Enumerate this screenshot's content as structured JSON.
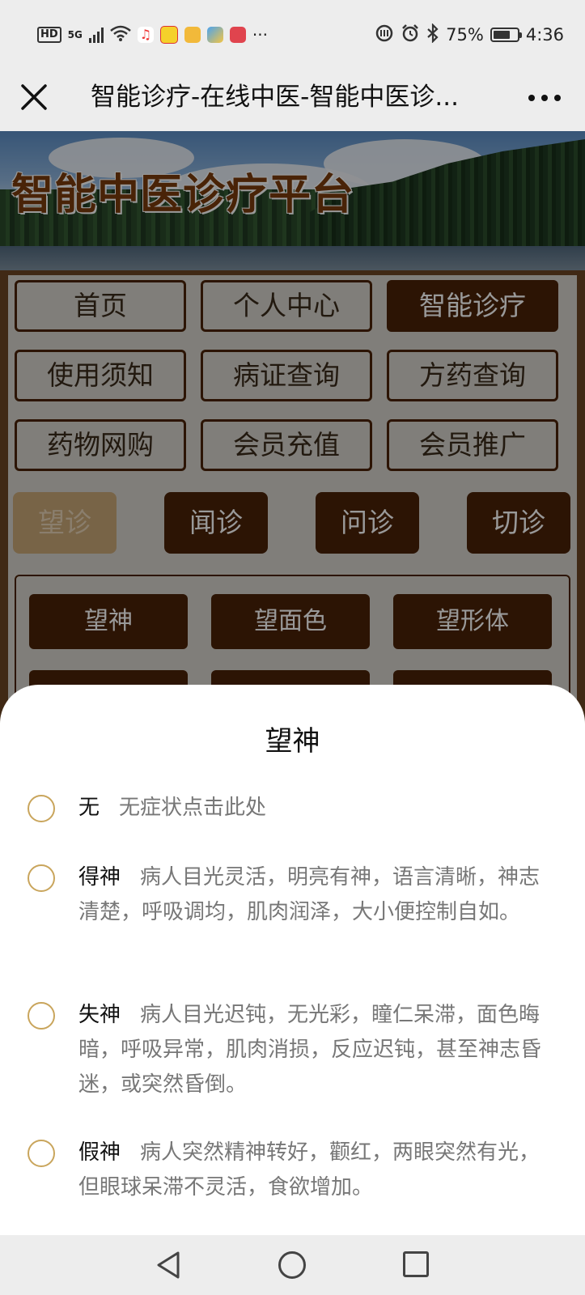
{
  "status_bar": {
    "network": "HD",
    "signal": "5G",
    "more": "···",
    "battery": "75%",
    "battery_level": 0.75,
    "time": "4:36"
  },
  "nav": {
    "title": "智能诊疗-在线中医-智能中医诊..."
  },
  "banner": {
    "title": "智能中医诊疗平台"
  },
  "menu": [
    "首页",
    "个人中心",
    "智能诊疗",
    "使用须知",
    "病证查询",
    "方药查询",
    "药物网购",
    "会员充值",
    "会员推广"
  ],
  "menu_active": "智能诊疗",
  "tabs": [
    "望诊",
    "闻诊",
    "问诊",
    "切诊"
  ],
  "tab_active": "望诊",
  "sub_items": [
    "望神",
    "望面色",
    "望形体"
  ],
  "sheet": {
    "title": "望神",
    "options": [
      {
        "label": "无",
        "desc": "无症状点击此处"
      },
      {
        "label": "得神",
        "desc": "病人目光灵活，明亮有神，语言清晰，神志清楚，呼吸调均，肌肉润泽，大小便控制自如。"
      },
      {
        "label": "失神",
        "desc": "病人目光迟钝，无光彩，瞳仁呆滞，面色晦暗，呼吸异常，肌肉消损，反应迟钝，甚至神志昏迷，或突然昏倒。"
      },
      {
        "label": "假神",
        "desc": "病人突然精神转好，颧红，两眼突然有光，但眼球呆滞不灵活，食欲增加。"
      }
    ]
  },
  "colors": {
    "brand_brown": "#4a2208",
    "tab_active": "#c8a777",
    "radio_border": "#c9a55c"
  }
}
